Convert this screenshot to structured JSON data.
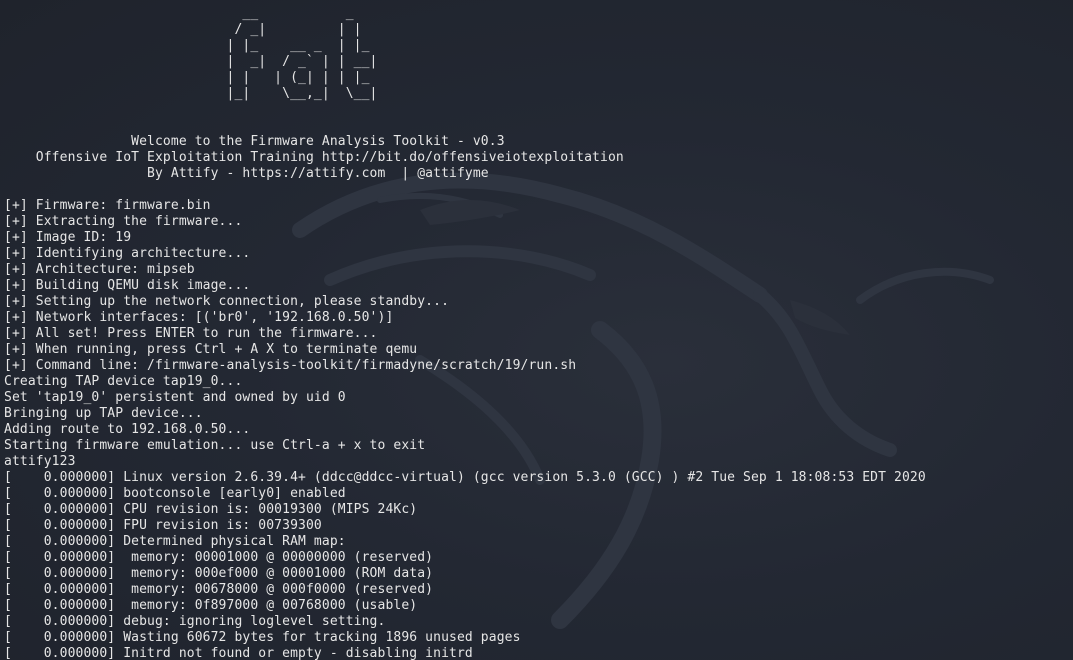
{
  "terminal": {
    "lines": [
      "                              __           _",
      "                             / _|         | |",
      "                            | |_    __ _  | |_",
      "                            |  _|  / _` | | __|",
      "                            | |   | (_| | | |_",
      "                            |_|    \\__,_|  \\__|",
      "",
      "",
      "                Welcome to the Firmware Analysis Toolkit - v0.3",
      "    Offensive IoT Exploitation Training http://bit.do/offensiveiotexploitation",
      "                  By Attify - https://attify.com  | @attifyme",
      "",
      "[+] Firmware: firmware.bin",
      "[+] Extracting the firmware...",
      "[+] Image ID: 19",
      "[+] Identifying architecture...",
      "[+] Architecture: mipseb",
      "[+] Building QEMU disk image...",
      "[+] Setting up the network connection, please standby...",
      "[+] Network interfaces: [('br0', '192.168.0.50')]",
      "[+] All set! Press ENTER to run the firmware...",
      "[+] When running, press Ctrl + A X to terminate qemu",
      "[+] Command line: /firmware-analysis-toolkit/firmadyne/scratch/19/run.sh",
      "Creating TAP device tap19_0...",
      "Set 'tap19_0' persistent and owned by uid 0",
      "Bringing up TAP device...",
      "Adding route to 192.168.0.50...",
      "Starting firmware emulation... use Ctrl-a + x to exit",
      "attify123",
      "[    0.000000] Linux version 2.6.39.4+ (ddcc@ddcc-virtual) (gcc version 5.3.0 (GCC) ) #2 Tue Sep 1 18:08:53 EDT 2020",
      "[    0.000000] bootconsole [early0] enabled",
      "[    0.000000] CPU revision is: 00019300 (MIPS 24Kc)",
      "[    0.000000] FPU revision is: 00739300",
      "[    0.000000] Determined physical RAM map:",
      "[    0.000000]  memory: 00001000 @ 00000000 (reserved)",
      "[    0.000000]  memory: 000ef000 @ 00001000 (ROM data)",
      "[    0.000000]  memory: 00678000 @ 000f0000 (reserved)",
      "[    0.000000]  memory: 0f897000 @ 00768000 (usable)",
      "[    0.000000] debug: ignoring loglevel setting.",
      "[    0.000000] Wasting 60672 bytes for tracking 1896 unused pages",
      "[    0.000000] Initrd not found or empty - disabling initrd"
    ]
  }
}
